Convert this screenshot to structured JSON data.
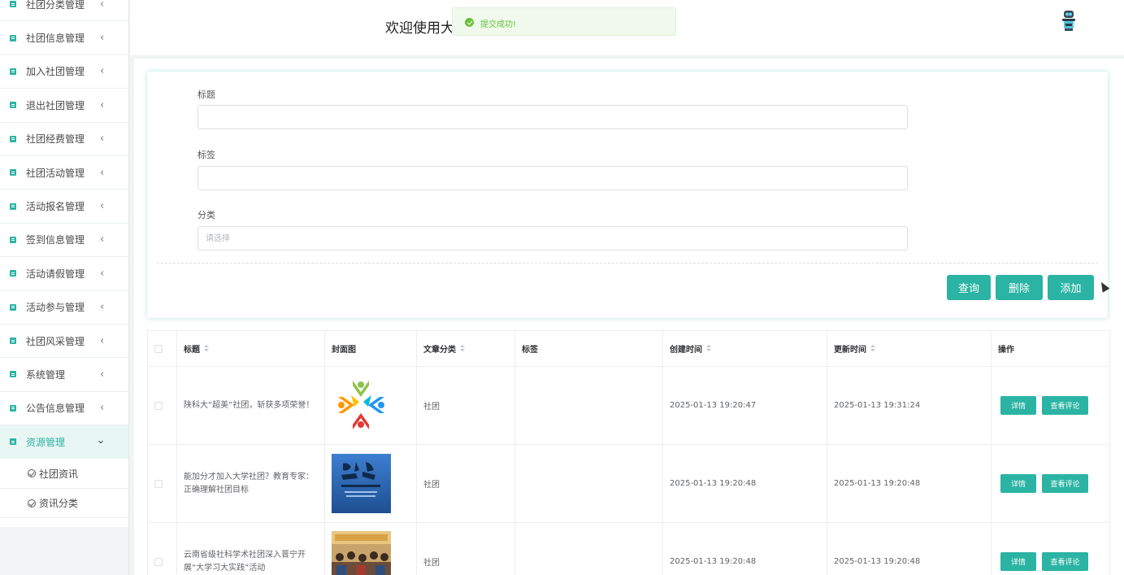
{
  "sidebar": {
    "items": [
      {
        "label": "社团分类管理"
      },
      {
        "label": "社团信息管理"
      },
      {
        "label": "加入社团管理"
      },
      {
        "label": "退出社团管理"
      },
      {
        "label": "社团经费管理"
      },
      {
        "label": "社团活动管理"
      },
      {
        "label": "活动报名管理"
      },
      {
        "label": "签到信息管理"
      },
      {
        "label": "活动请假管理"
      },
      {
        "label": "活动参与管理"
      },
      {
        "label": "社团风采管理"
      },
      {
        "label": "系统管理"
      },
      {
        "label": "公告信息管理"
      },
      {
        "label": "资源管理"
      }
    ],
    "sub_items": [
      {
        "label": "社团资讯"
      },
      {
        "label": "资讯分类"
      }
    ]
  },
  "header": {
    "welcome": "欢迎使用大",
    "toast": "提交成功!"
  },
  "search": {
    "title_label": "标题",
    "title_value": "",
    "tag_label": "标签",
    "tag_value": "",
    "category_label": "分类",
    "category_placeholder": "请选择",
    "query_button": "查询",
    "delete_button": "删除",
    "add_button": "添加"
  },
  "table": {
    "columns": [
      "标题",
      "封面图",
      "文章分类",
      "标签",
      "创建时间",
      "更新时间",
      "操作"
    ],
    "rows": [
      {
        "title": "陕科大“超美”社团，斩获多项荣誉！",
        "category": "社团",
        "tag": "",
        "created": "2025-01-13 19:20:47",
        "updated": "2025-01-13 19:31:24"
      },
      {
        "title": "能加分才加入大学社团？教育专家：正确理解社团目标",
        "category": "社团",
        "tag": "",
        "created": "2025-01-13 19:20:48",
        "updated": "2025-01-13 19:20:48"
      },
      {
        "title": "云南省级社科学术社团深入晋宁开展“大学习大实践”活动",
        "category": "社团",
        "tag": "",
        "created": "2025-01-13 19:20:48",
        "updated": "2025-01-13 19:20:48"
      }
    ],
    "detail_button": "详情",
    "comment_button": "查看评论"
  },
  "colors": {
    "accent": "#2bb3a3",
    "success": "#67c23a"
  }
}
